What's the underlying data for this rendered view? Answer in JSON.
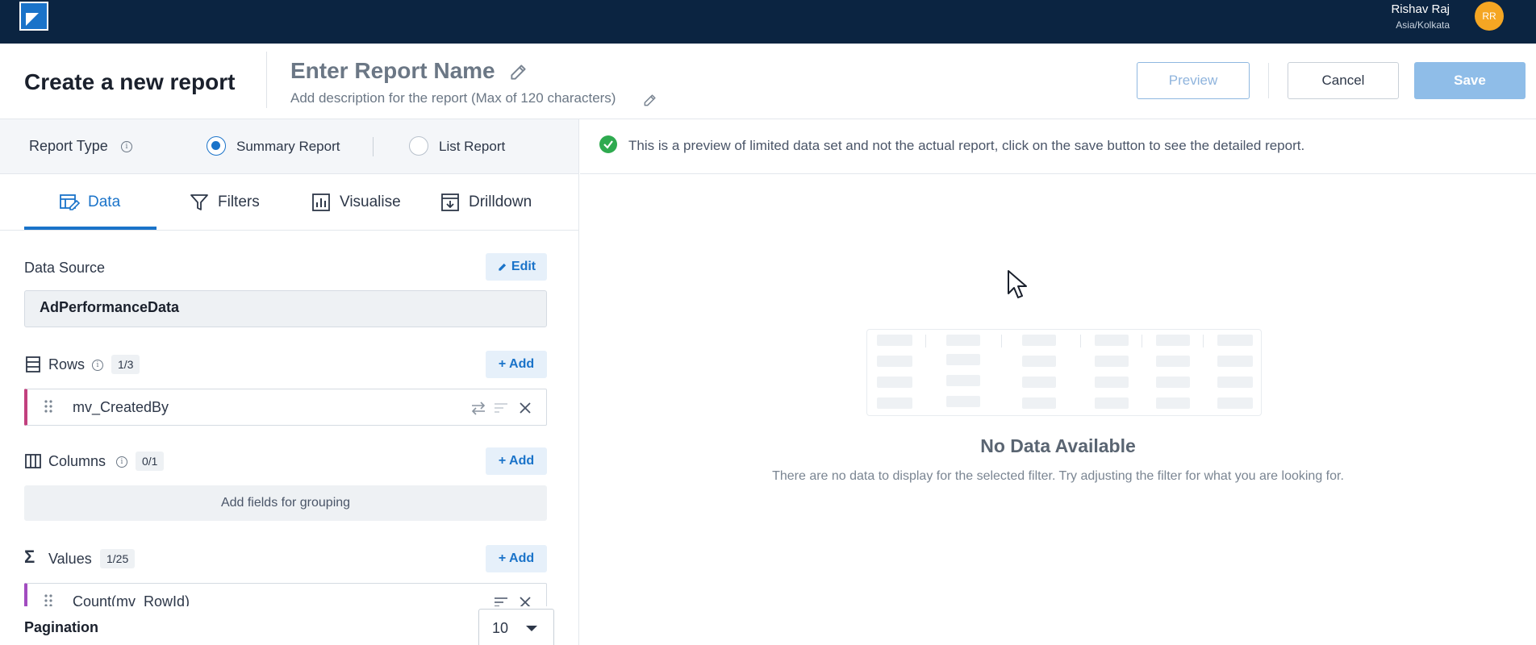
{
  "topbar": {
    "user_name": "Rishav Raj",
    "user_timezone": "Asia/Kolkata",
    "avatar_initials": "RR"
  },
  "header": {
    "page_title": "Create a new report",
    "report_name_placeholder": "Enter Report Name",
    "report_description_placeholder": "Add description for the report (Max of 120 characters)",
    "preview_label": "Preview",
    "cancel_label": "Cancel",
    "save_label": "Save"
  },
  "report_type": {
    "label": "Report Type",
    "options": [
      {
        "label": "Summary Report",
        "selected": true
      },
      {
        "label": "List Report",
        "selected": false
      }
    ]
  },
  "tabs": [
    {
      "label": "Data",
      "icon": "data-table-icon",
      "active": true
    },
    {
      "label": "Filters",
      "icon": "filter-icon",
      "active": false
    },
    {
      "label": "Visualise",
      "icon": "bar-chart-icon",
      "active": false
    },
    {
      "label": "Drilldown",
      "icon": "drilldown-icon",
      "active": false
    }
  ],
  "data_source": {
    "label": "Data Source",
    "edit_label": "Edit",
    "value": "AdPerformanceData"
  },
  "rows": {
    "label": "Rows",
    "count": "1/3",
    "add_label": "+ Add",
    "items": [
      "mv_CreatedBy"
    ]
  },
  "columns": {
    "label": "Columns",
    "count": "0/1",
    "add_label": "+ Add",
    "empty_text": "Add fields for grouping"
  },
  "values": {
    "label": "Values",
    "count": "1/25",
    "add_label": "+ Add",
    "items": [
      "Count(mv_RowId)"
    ]
  },
  "pagination": {
    "label": "Pagination",
    "value": "10"
  },
  "preview": {
    "notice": "This is a preview of limited data set and not the actual report, click on the save button to see the detailed report.",
    "empty_title": "No Data Available",
    "empty_subtitle": "There are no data to display for the selected filter. Try adjusting the filter for what you are looking for."
  },
  "colors": {
    "topbar_bg": "#0b2441",
    "accent": "#1a73c9",
    "save_disabled": "#8fbde8",
    "row_accent": "#c2407e",
    "success": "#2eaa4f",
    "avatar": "#f5a623"
  }
}
